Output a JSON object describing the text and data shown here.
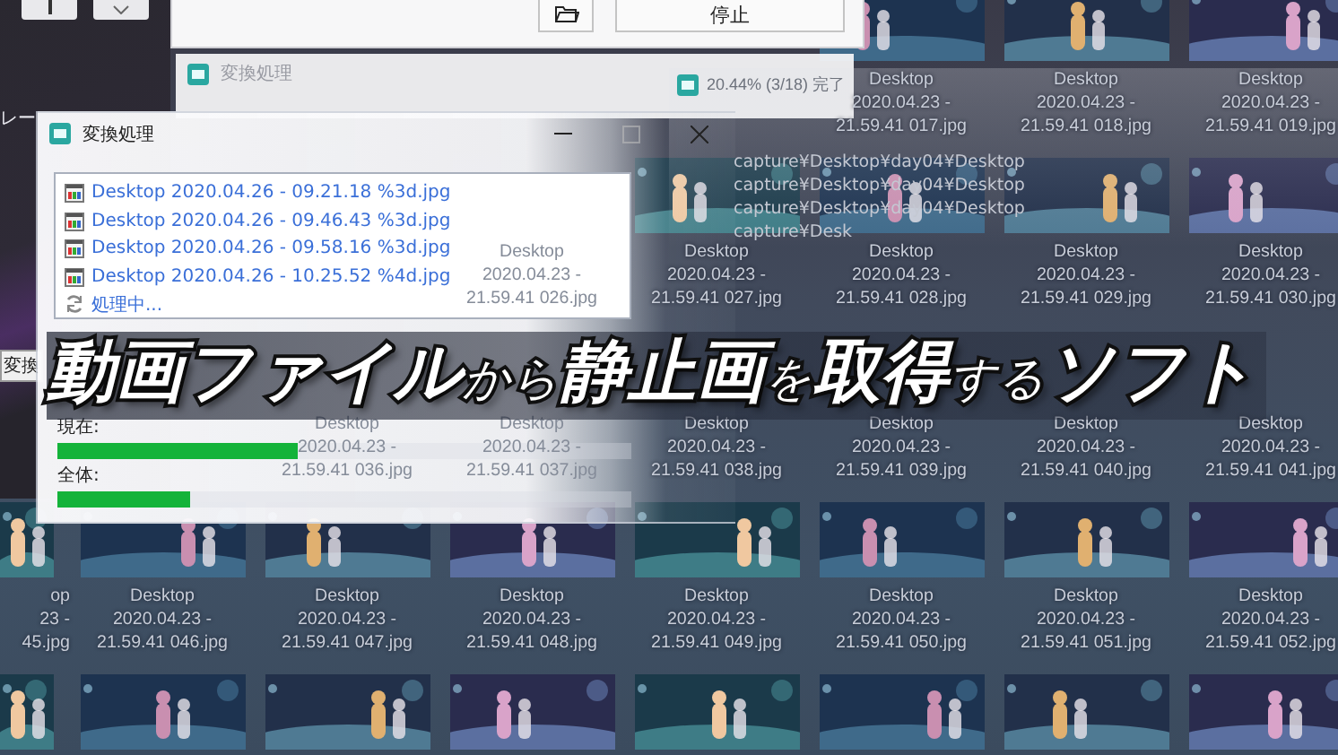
{
  "left_panel": {
    "toolbar": [
      {
        "kind": "bar"
      },
      {
        "kind": "chevron"
      }
    ],
    "label": "レー",
    "button": "変換"
  },
  "top_window": {
    "buttons": [
      {
        "kind": "folder"
      },
      {
        "kind": "text",
        "label": "停止"
      }
    ]
  },
  "background_window": {
    "title": "変換処理"
  },
  "converter_window": {
    "title": "20.44% (3/18) 完了",
    "paths": [
      "capture¥Desktop¥day04¥Desktop",
      "capture¥Desktop¥day04¥Desktop",
      "capture¥Desktop¥day04¥Desktop",
      "capture¥Desk"
    ]
  },
  "progress_window": {
    "title": "変換処理",
    "files": [
      "Desktop 2020.04.26 - 09.21.18 %3d.jpg",
      "Desktop 2020.04.26 - 09.46.43 %3d.jpg",
      "Desktop 2020.04.26 - 09.58.16 %3d.jpg",
      "Desktop 2020.04.26 - 10.25.52 %4d.jpg"
    ],
    "status": "処理中...",
    "current": {
      "label": "現在:",
      "level": 0.42
    },
    "total": {
      "label": "全体:",
      "level": 0.23
    }
  },
  "headline": [
    {
      "text": "動画ファイル",
      "kind": "large"
    },
    {
      "text": "から",
      "kind": "small"
    },
    {
      "text": "静止画",
      "kind": "large"
    },
    {
      "text": "を",
      "kind": "small"
    },
    {
      "text": "取得",
      "kind": "large"
    },
    {
      "text": "する",
      "kind": "small"
    },
    {
      "text": "ソフト",
      "kind": "large"
    }
  ],
  "file_grid": {
    "rows": [
      [
        "",
        "",
        "",
        "",
        "",
        {
          "lines": [
            "Desktop",
            "2020.04.23 -",
            "21.59.41 017.jpg"
          ]
        },
        {
          "lines": [
            "Desktop",
            "2020.04.23 -",
            "21.59.41 018.jpg"
          ]
        },
        {
          "lines": [
            "Desktop",
            "2020.04.23 -",
            "21.59.41 019.jpg"
          ]
        }
      ],
      [
        "",
        "",
        "",
        {
          "lines": [
            "Desktop",
            "2020.04.23 -",
            "21.59.41 026.jpg"
          ]
        },
        {
          "lines": [
            "Desktop",
            "2020.04.23 -",
            "21.59.41 027.jpg"
          ]
        },
        {
          "lines": [
            "Desktop",
            "2020.04.23 -",
            "21.59.41 028.jpg"
          ]
        },
        {
          "lines": [
            "Desktop",
            "2020.04.23 -",
            "21.59.41 029.jpg"
          ]
        },
        {
          "lines": [
            "Desktop",
            "2020.04.23 -",
            "21.59.41 030.jpg"
          ]
        }
      ],
      [
        "",
        "",
        {
          "lines": [
            "Desktop",
            "2020.04.23 -",
            "21.59.41 036.jpg"
          ]
        },
        {
          "lines": [
            "Desktop",
            "2020.04.23 -",
            "21.59.41 037.jpg"
          ]
        },
        {
          "lines": [
            "Desktop",
            "2020.04.23 -",
            "21.59.41 038.jpg"
          ]
        },
        {
          "lines": [
            "Desktop",
            "2020.04.23 -",
            "21.59.41 039.jpg"
          ]
        },
        {
          "lines": [
            "Desktop",
            "2020.04.23 -",
            "21.59.41 040.jpg"
          ]
        },
        {
          "lines": [
            "Desktop",
            "2020.04.23 -",
            "21.59.41 041.jpg"
          ]
        }
      ],
      [
        {
          "lines": [
            "op",
            "23 -",
            "45.jpg"
          ]
        },
        {
          "lines": [
            "Desktop",
            "2020.04.23 -",
            "21.59.41 046.jpg"
          ]
        },
        {
          "lines": [
            "Desktop",
            "2020.04.23 -",
            "21.59.41 047.jpg"
          ]
        },
        {
          "lines": [
            "Desktop",
            "2020.04.23 -",
            "21.59.41 048.jpg"
          ]
        },
        {
          "lines": [
            "Desktop",
            "2020.04.23 -",
            "21.59.41 049.jpg"
          ]
        },
        {
          "lines": [
            "Desktop",
            "2020.04.23 -",
            "21.59.41 050.jpg"
          ]
        },
        {
          "lines": [
            "Desktop",
            "2020.04.23 -",
            "21.59.41 051.jpg"
          ]
        },
        {
          "lines": [
            "Desktop",
            "2020.04.23 -",
            "21.59.41 052.jpg"
          ]
        }
      ]
    ]
  }
}
